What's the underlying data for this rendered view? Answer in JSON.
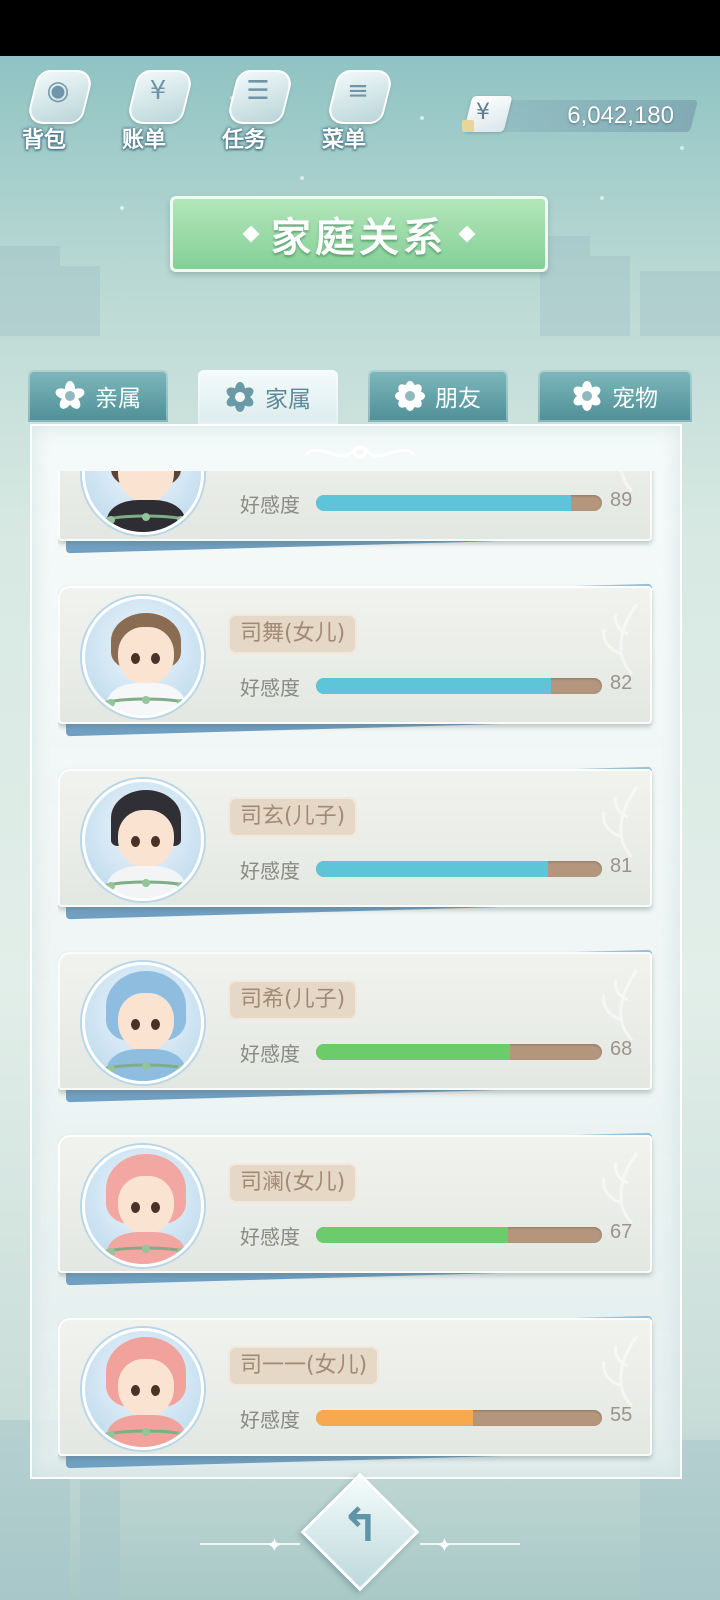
{
  "toolbar": {
    "items": [
      {
        "label": "背包",
        "icon": "bag-icon",
        "glyph": "◉"
      },
      {
        "label": "账单",
        "icon": "bill-icon",
        "glyph": "¥"
      },
      {
        "label": "任务",
        "icon": "task-icon",
        "glyph": "☰"
      },
      {
        "label": "菜单",
        "icon": "menu-icon",
        "glyph": "≡"
      }
    ]
  },
  "money": {
    "currency": "¥",
    "value": "6,042,180"
  },
  "page": {
    "title": "家庭关系"
  },
  "tabs": [
    {
      "label": "亲属",
      "active": false
    },
    {
      "label": "家属",
      "active": true
    },
    {
      "label": "朋友",
      "active": false
    },
    {
      "label": "宠物",
      "active": false
    }
  ],
  "list": {
    "affinity_label": "好感度",
    "members": [
      {
        "name": "",
        "affinity": 89,
        "bar_color": "#5ec4d8",
        "avatar": "boy-black-hoodie"
      },
      {
        "name": "司舞(女儿)",
        "affinity": 82,
        "bar_color": "#5ec4d8",
        "avatar": "girl-bun"
      },
      {
        "name": "司玄(儿子)",
        "affinity": 81,
        "bar_color": "#5ec4d8",
        "avatar": "boy-cap"
      },
      {
        "name": "司希(儿子)",
        "affinity": 68,
        "bar_color": "#6ccb6a",
        "avatar": "shark-hood"
      },
      {
        "name": "司澜(女儿)",
        "affinity": 67,
        "bar_color": "#6ccb6a",
        "avatar": "pink-hood"
      },
      {
        "name": "司一一(女儿)",
        "affinity": 55,
        "bar_color": "#f7a94f",
        "avatar": "pink-hood-2"
      }
    ]
  },
  "back_button": {
    "glyph": "↰"
  },
  "colors": {
    "accent_title": "#84cf97",
    "tab_inactive": "#4f8f97",
    "bar_track": "#b3967c"
  }
}
